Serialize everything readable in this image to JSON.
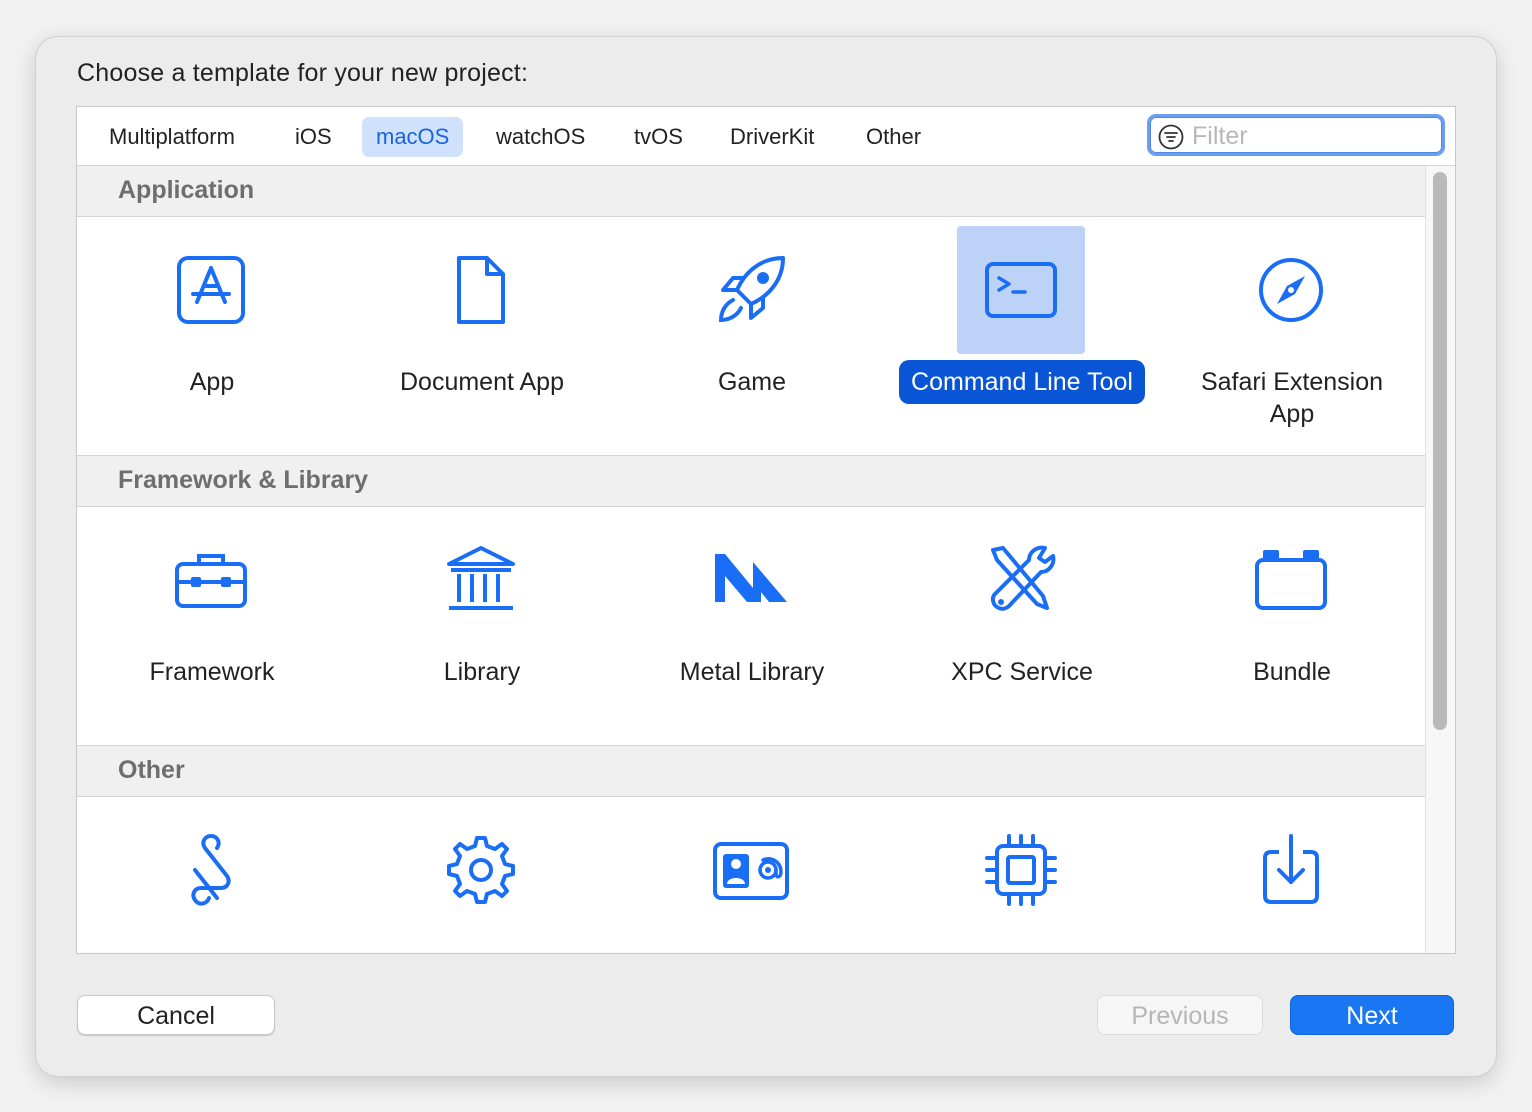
{
  "dialog": {
    "prompt": "Choose a template for your new project:"
  },
  "tabs": [
    {
      "label": "Multiplatform",
      "selected": false
    },
    {
      "label": "iOS",
      "selected": false
    },
    {
      "label": "macOS",
      "selected": true
    },
    {
      "label": "watchOS",
      "selected": false
    },
    {
      "label": "tvOS",
      "selected": false
    },
    {
      "label": "DriverKit",
      "selected": false
    },
    {
      "label": "Other",
      "selected": false
    }
  ],
  "filter": {
    "placeholder": "Filter",
    "value": "",
    "icon": "filter-icon"
  },
  "sections": [
    {
      "title": "Application",
      "items": [
        {
          "label": "App",
          "icon": "app-store-icon"
        },
        {
          "label": "Document App",
          "icon": "document-icon"
        },
        {
          "label": "Game",
          "icon": "rocket-icon"
        },
        {
          "label": "Command Line Tool",
          "icon": "terminal-icon",
          "selected": true
        },
        {
          "label": "Safari Extension App",
          "icon": "compass-icon"
        }
      ]
    },
    {
      "title": "Framework & Library",
      "items": [
        {
          "label": "Framework",
          "icon": "toolbox-icon"
        },
        {
          "label": "Library",
          "icon": "building-columns-icon"
        },
        {
          "label": "Metal Library",
          "icon": "metal-icon"
        },
        {
          "label": "XPC Service",
          "icon": "wrench-screwdriver-icon"
        },
        {
          "label": "Bundle",
          "icon": "bundle-icon"
        }
      ]
    },
    {
      "title": "Other",
      "items": [
        {
          "label": "",
          "icon": "scroll-icon"
        },
        {
          "label": "",
          "icon": "gear-icon"
        },
        {
          "label": "",
          "icon": "contact-card-icon"
        },
        {
          "label": "",
          "icon": "chip-icon"
        },
        {
          "label": "",
          "icon": "download-tray-icon"
        }
      ]
    }
  ],
  "buttons": {
    "cancel": "Cancel",
    "previous": "Previous",
    "next": "Next"
  },
  "colors": {
    "accent": "#1977f3",
    "selected_label_bg": "#0a55d6",
    "selected_icon_bg": "#bcd2f6",
    "icon_blue": "#1a6ef5",
    "tab_selected_bg": "#cfe1fb"
  }
}
